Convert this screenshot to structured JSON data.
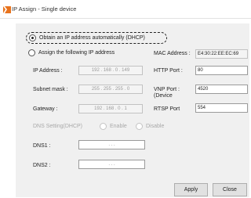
{
  "window": {
    "title": "IP Assign - Single device"
  },
  "dhcp_option": {
    "label": "Obtain an IP address automatically (DHCP)",
    "checked": true
  },
  "static_option": {
    "label": "Assign the following IP address",
    "checked": false
  },
  "mac": {
    "label": "MAC Address :",
    "value": "E4:30:22:EE:EC:69"
  },
  "ip_address": {
    "label": "IP Address :",
    "value": "192 . 168 . 0 . 149"
  },
  "subnet_mask": {
    "label": "Subnet mask :",
    "value": "255 . 255 . 255 . 0"
  },
  "gateway": {
    "label": "Gateway :",
    "value": "192 . 168 . 0 . 1"
  },
  "http_port": {
    "label": "HTTP Port :",
    "value": "80"
  },
  "vnp_port": {
    "label_line1": "VNP Port :",
    "label_line2": "(Device",
    "value": "4520"
  },
  "rtsp_port": {
    "label": "RTSP Port",
    "value": "554"
  },
  "dns_setting": {
    "label": "DNS Setting(DHCP)",
    "enable_label": "Enable",
    "disable_label": "Disable"
  },
  "dns1": {
    "label": "DNS1 :",
    "value": ".       .       ."
  },
  "dns2": {
    "label": "DNS2 :",
    "value": ".       .       ."
  },
  "buttons": {
    "apply": "Apply",
    "close": "Close"
  },
  "colors": {
    "dialog_bg": "#f0f0f0",
    "icon_orange": "#e8731d"
  }
}
